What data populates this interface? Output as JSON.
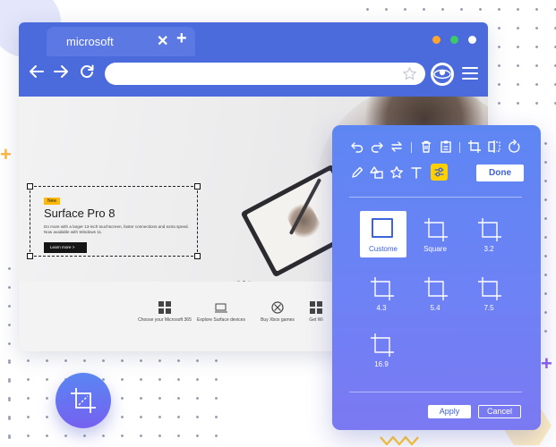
{
  "browser": {
    "tab_title": "microsoft",
    "close_glyph": "✕",
    "new_tab_glyph": "+",
    "address_value": "",
    "window_dots": [
      "#ffa629",
      "#3dc96a",
      "#ffffff"
    ],
    "icons": [
      "back-arrow-icon",
      "forward-arrow-icon",
      "reload-icon",
      "star-icon",
      "menu-icon"
    ]
  },
  "webpage": {
    "promo": {
      "badge": "New",
      "title": "Surface Pro 8",
      "description": "Do more with a larger 13-inch touchscreen, faster connections and extra speed. Now available with Windows 11.",
      "cta": "Learn more  >"
    },
    "quick_links": [
      {
        "label": "Choose your Microsoft 365",
        "icon": "windows-grid-icon"
      },
      {
        "label": "Explore Surface devices",
        "icon": "laptop-icon"
      },
      {
        "label": "Buy Xbox games",
        "icon": "xbox-icon"
      },
      {
        "label": "Get Wi",
        "icon": "windows-grid-icon"
      }
    ]
  },
  "crop_panel": {
    "toolbar_icons": [
      "undo-icon",
      "redo-icon",
      "swap-icon",
      "delete-icon",
      "clipboard-icon",
      "crop-icon",
      "flip-icon",
      "rotate-icon",
      "pencil-icon",
      "shapes-icon",
      "star-outline-icon",
      "text-icon",
      "adjust-icon"
    ],
    "active_tool": "adjust-icon",
    "done_label": "Done",
    "ratios": [
      {
        "label": "Custome",
        "selected": true
      },
      {
        "label": "Square",
        "selected": false
      },
      {
        "label": "3.2",
        "selected": false
      },
      {
        "label": "4.3",
        "selected": false
      },
      {
        "label": "5.4",
        "selected": false
      },
      {
        "label": "7.5",
        "selected": false
      },
      {
        "label": "16.9",
        "selected": false
      }
    ],
    "apply_label": "Apply",
    "cancel_label": "Cancel"
  },
  "decor": {
    "badge_icon": "crop-resize-icon",
    "accent": "#5b78e3",
    "plus_colors": [
      "#ffb443",
      "#8b5cf6"
    ]
  }
}
